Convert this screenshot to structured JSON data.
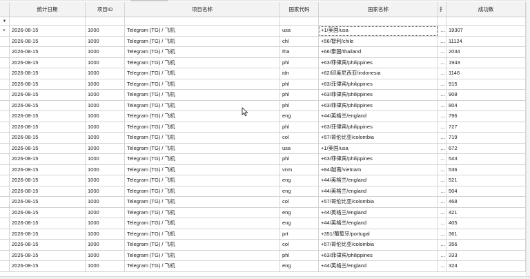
{
  "columns": [
    "统计日期",
    "项目ID",
    "项目名称",
    "国家代码",
    "国家名称",
    "扌",
    "成功数"
  ],
  "filter_row_icon": "▼",
  "row_indicator_icon": "▸",
  "rows": [
    [
      "2026-08-15",
      "1000",
      "Telegram (TG) / 飞机",
      "usa",
      "+1/美国/usa",
      "…",
      "19307"
    ],
    [
      "2026-08-15",
      "1000",
      "Telegram (TG) / 飞机",
      "chl",
      "+56/智利/chile",
      "…",
      "11124"
    ],
    [
      "2026-08-15",
      "1000",
      "Telegram (TG) / 飞机",
      "tha",
      "+66/泰国/thailand",
      "…",
      "2034"
    ],
    [
      "2026-08-15",
      "1000",
      "Telegram (TG) / 飞机",
      "phl",
      "+63/菲律宾/philippines",
      "…",
      "1943"
    ],
    [
      "2026-08-15",
      "1000",
      "Telegram (TG) / 飞机",
      "idn",
      "+62/印度尼西亚/indonesia",
      "…",
      "1146"
    ],
    [
      "2026-08-15",
      "1000",
      "Telegram (TG) / 飞机",
      "phl",
      "+63/菲律宾/philippines",
      "…",
      "915"
    ],
    [
      "2026-08-15",
      "1000",
      "Telegram (TG) / 飞机",
      "phl",
      "+63/菲律宾/philippines",
      "…",
      "908"
    ],
    [
      "2026-08-15",
      "1000",
      "Telegram (TG) / 飞机",
      "phl",
      "+63/菲律宾/philippines",
      "…",
      "804"
    ],
    [
      "2026-08-15",
      "1000",
      "Telegram (TG) / 飞机",
      "eng",
      "+44/英格兰/england",
      "…",
      "796"
    ],
    [
      "2026-08-15",
      "1000",
      "Telegram (TG) / 飞机",
      "phl",
      "+63/菲律宾/philippines",
      "…",
      "727"
    ],
    [
      "2026-08-15",
      "1000",
      "Telegram (TG) / 飞机",
      "col",
      "+57/哥伦比亚/colombia",
      "…",
      "719"
    ],
    [
      "2026-08-15",
      "1000",
      "Telegram (TG) / 飞机",
      "usa",
      "+1/美国/usa",
      "…",
      "672"
    ],
    [
      "2026-08-15",
      "1000",
      "Telegram (TG) / 飞机",
      "phl",
      "+63/菲律宾/philippines",
      "…",
      "543"
    ],
    [
      "2026-08-15",
      "1000",
      "Telegram (TG) / 飞机",
      "vnm",
      "+84/越南/vietnam",
      "…",
      "536"
    ],
    [
      "2026-08-15",
      "1000",
      "Telegram (TG) / 飞机",
      "eng",
      "+44/英格兰/england",
      "…",
      "521"
    ],
    [
      "2026-08-15",
      "1000",
      "Telegram (TG) / 飞机",
      "eng",
      "+44/英格兰/england",
      "…",
      "504"
    ],
    [
      "2026-08-15",
      "1000",
      "Telegram (TG) / 飞机",
      "col",
      "+57/哥伦比亚/colombia",
      "…",
      "468"
    ],
    [
      "2026-08-15",
      "1000",
      "Telegram (TG) / 飞机",
      "eng",
      "+44/英格兰/england",
      "…",
      "421"
    ],
    [
      "2026-08-15",
      "1000",
      "Telegram (TG) / 飞机",
      "eng",
      "+44/英格兰/england",
      "…",
      "405"
    ],
    [
      "2026-08-15",
      "1000",
      "Telegram (TG) / 飞机",
      "prt",
      "+351/葡萄牙/portugal",
      "…",
      "361"
    ],
    [
      "2026-08-15",
      "1000",
      "Telegram (TG) / 飞机",
      "col",
      "+57/哥伦比亚/colombia",
      "…",
      "356"
    ],
    [
      "2026-08-15",
      "1000",
      "Telegram (TG) / 飞机",
      "phl",
      "+63/菲律宾/philippines",
      "…",
      "333"
    ],
    [
      "2026-08-15",
      "1000",
      "Telegram (TG) / 飞机",
      "eng",
      "+44/英格兰/england",
      "…",
      "324"
    ]
  ],
  "colors": {
    "header_bg": "#f3f3f3",
    "grid_line": "#d4d4d4",
    "cell_bg": "#ffffff"
  }
}
